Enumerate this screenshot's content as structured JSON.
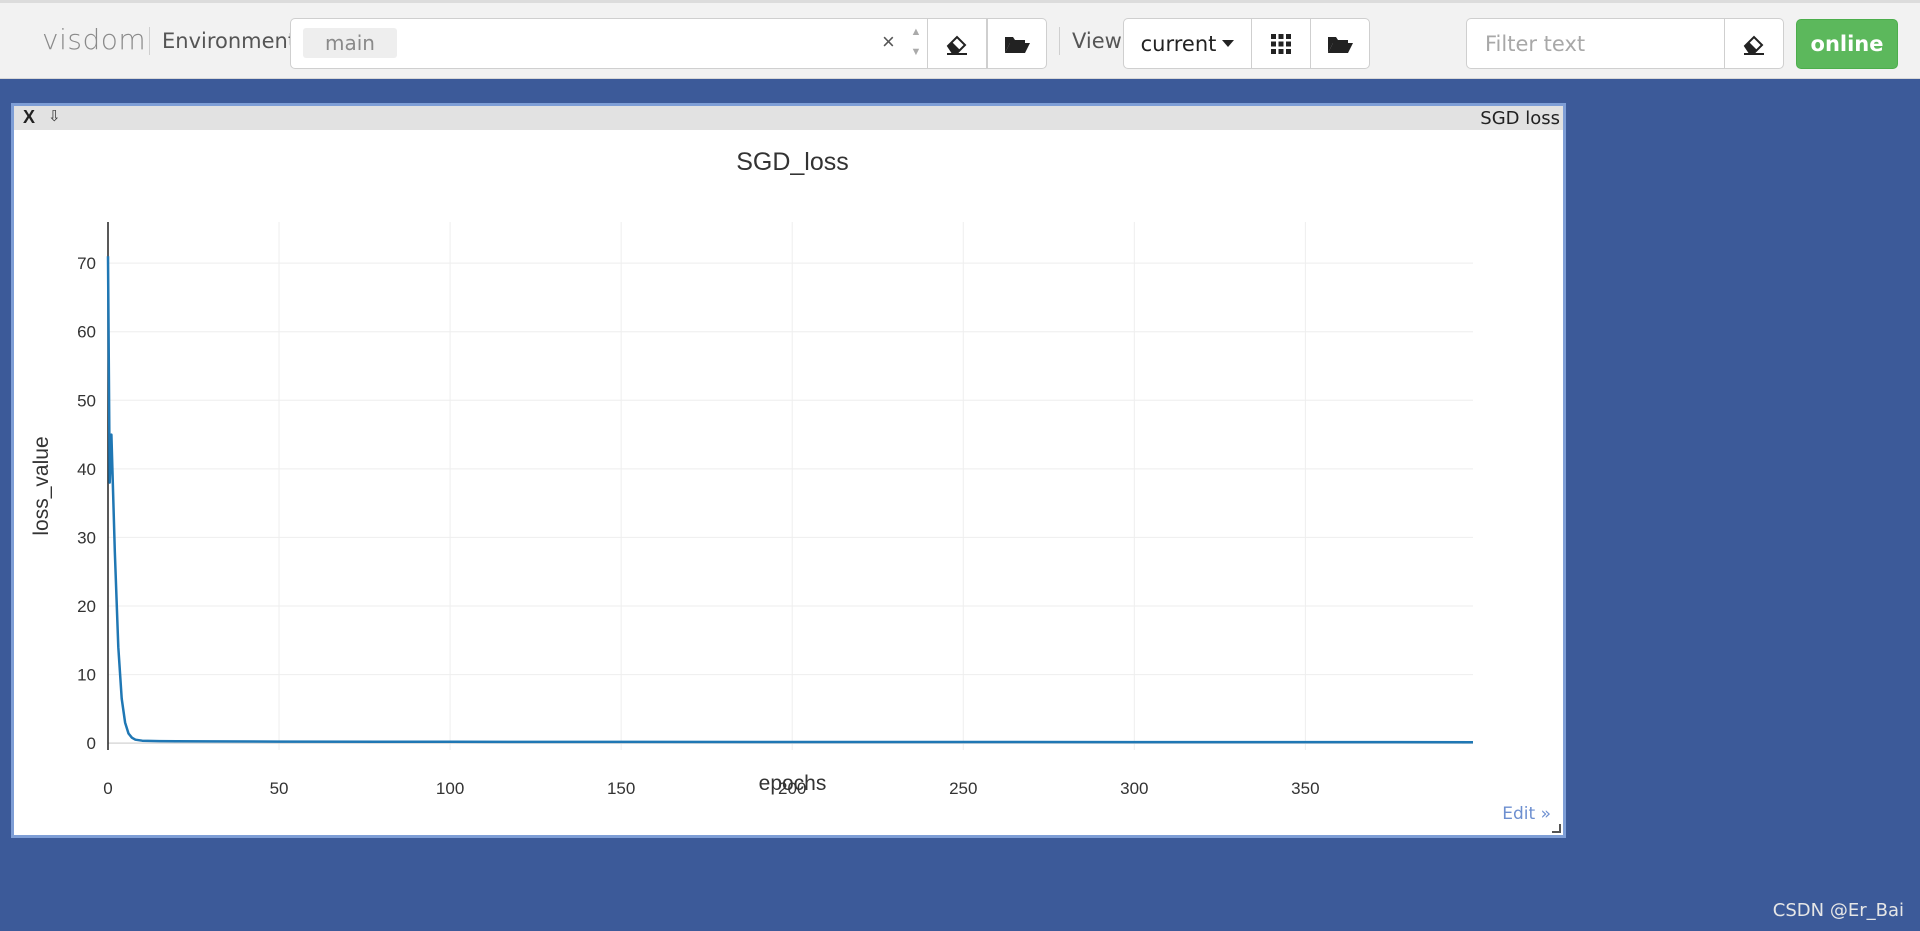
{
  "navbar": {
    "brand": "visdom",
    "environment_label": "Environment",
    "environment_tag": "main",
    "clear_symbol": "×",
    "view_label": "View",
    "view_value": "current",
    "filter_placeholder": "Filter text",
    "status_label": "online",
    "icons": [
      "eraser-icon",
      "folder-open-icon",
      "grid-icon",
      "folder-open-icon",
      "eraser-icon"
    ],
    "status_color": "#5cb85c"
  },
  "pane": {
    "close_label": "X",
    "download_symbol": "⇩",
    "title": "SGD loss",
    "edit_label": "Edit »",
    "border_color": "#7e9ed6"
  },
  "chart_data": {
    "type": "line",
    "title": "SGD_loss",
    "xlabel": "epochs",
    "ylabel": "loss_value",
    "xlim": [
      0,
      399
    ],
    "ylim": [
      -1,
      76
    ],
    "xticks": [
      0,
      50,
      100,
      150,
      200,
      250,
      300,
      350
    ],
    "yticks": [
      0,
      10,
      20,
      30,
      40,
      50,
      60,
      70
    ],
    "grid": true,
    "line_color": "#1f77b4",
    "series": [
      {
        "x": [
          0,
          0.5,
          1,
          2,
          3,
          4,
          5,
          6,
          7,
          8,
          10,
          15,
          20,
          30,
          50,
          100,
          150,
          200,
          250,
          300,
          350,
          399
        ],
        "y": [
          71,
          38,
          45,
          28,
          14,
          6.5,
          3,
          1.4,
          0.8,
          0.5,
          0.35,
          0.3,
          0.28,
          0.25,
          0.22,
          0.2,
          0.18,
          0.17,
          0.16,
          0.15,
          0.15,
          0.14
        ]
      }
    ]
  },
  "watermark": "CSDN @Er_Bai"
}
